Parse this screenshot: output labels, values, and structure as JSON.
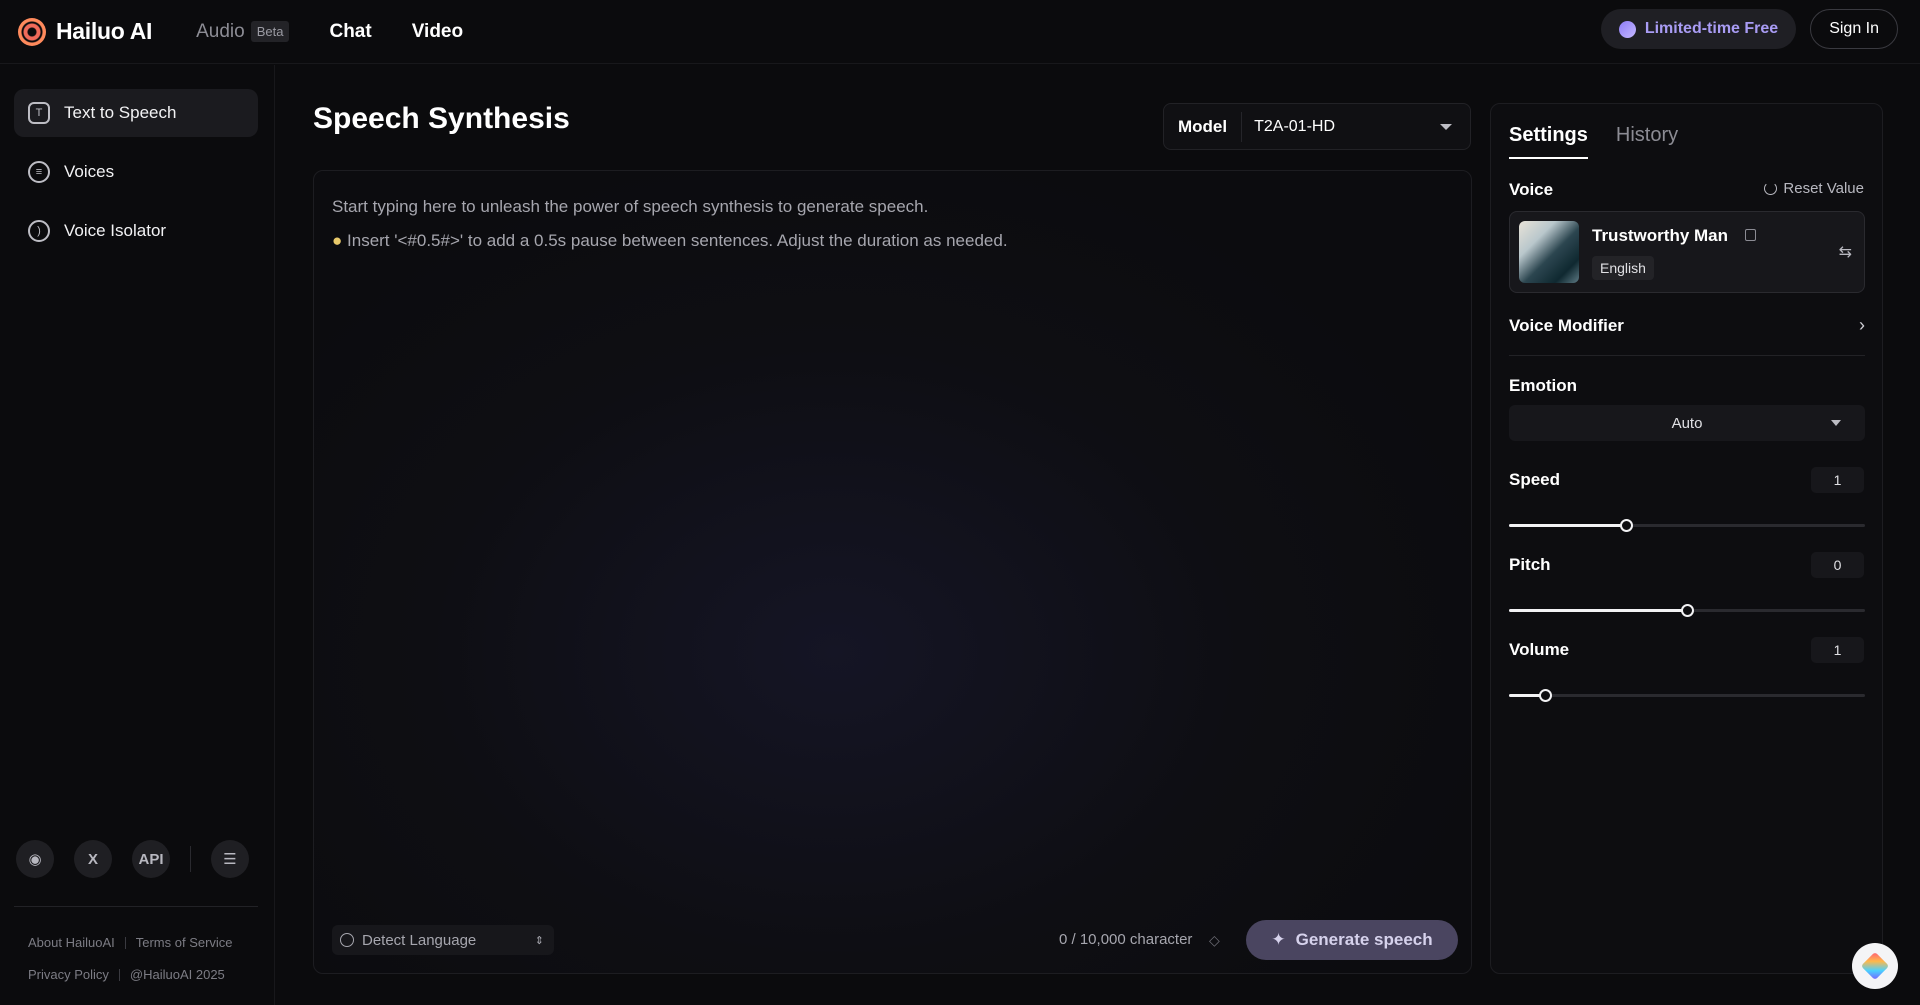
{
  "header": {
    "brand": "Hailuo AI",
    "nav": [
      {
        "label": "Audio",
        "badge": "Beta"
      },
      {
        "label": "Chat"
      },
      {
        "label": "Video"
      }
    ],
    "promo": "Limited-time Free",
    "sign_in": "Sign In"
  },
  "sidebar": {
    "items": [
      {
        "label": "Text to Speech",
        "icon": "text-to-speech-icon",
        "active": true
      },
      {
        "label": "Voices",
        "icon": "voices-icon"
      },
      {
        "label": "Voice Isolator",
        "icon": "voice-isolator-icon"
      }
    ],
    "social": {
      "discord": "discord-icon",
      "x": "X",
      "api": "API",
      "menu": "menu-icon"
    },
    "footer": {
      "about": "About HailuoAI",
      "terms": "Terms of Service",
      "privacy": "Privacy Policy",
      "copyright": "@HailuoAI 2025"
    }
  },
  "main": {
    "title": "Speech Synthesis",
    "model": {
      "label": "Model",
      "value": "T2A-01-HD"
    },
    "editor": {
      "placeholder_line1": "Start typing here to unleash the power of speech synthesis to generate speech.",
      "placeholder_line2": "Insert '<#0.5#>' to add a 0.5s pause between sentences. Adjust the duration as needed."
    },
    "language": "Detect Language",
    "char_count": "0 / 10,000 character",
    "generate": "Generate speech"
  },
  "panel": {
    "tabs": [
      "Settings",
      "History"
    ],
    "voice_label": "Voice",
    "reset": "Reset Value",
    "voice": {
      "name": "Trustworthy Man",
      "language": "English"
    },
    "voice_modifier": "Voice Modifier",
    "emotion": {
      "label": "Emotion",
      "value": "Auto"
    },
    "speed": {
      "label": "Speed",
      "value": "1",
      "fraction": 0.33
    },
    "pitch": {
      "label": "Pitch",
      "value": "0",
      "fraction": 0.5
    },
    "volume": {
      "label": "Volume",
      "value": "1",
      "fraction": 0.1
    }
  },
  "colors": {
    "accent": "#a99cf4",
    "background": "#0b0b0d",
    "generate_button": "#4a4560"
  }
}
